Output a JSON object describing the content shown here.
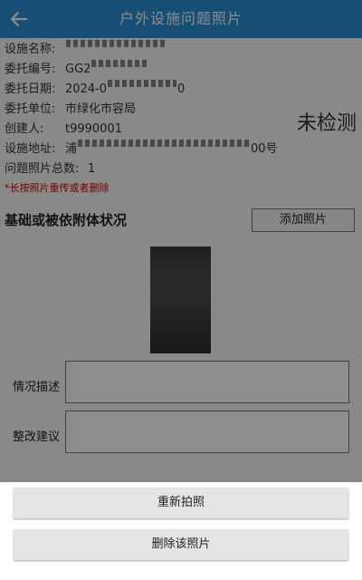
{
  "header": {
    "title": "户外设施问题照片",
    "back_icon": "arrow-left-icon"
  },
  "info": {
    "name_label": "设施名称:",
    "name_value": "",
    "code_label": "委托编号:",
    "code_value": "GG2",
    "date_label": "委托日期:",
    "date_value": "2024-0",
    "date_tail": "0",
    "unit_label": "委托单位:",
    "unit_value": "市绿化市容局",
    "creator_label": "创建人:",
    "creator_value": "t9990001",
    "address_label": "设施地址:",
    "address_value": "浦",
    "address_tail": "00号",
    "count_label": "问题照片总数:",
    "count_value": "1",
    "hint": "*长按照片重传或者删除"
  },
  "status": "未检测",
  "section": {
    "title": "基础或被依附体状况",
    "add_button": "添加照片"
  },
  "form": {
    "desc_label": "情况描述",
    "suggest_label": "整改建议"
  },
  "sheet": {
    "retake": "重新拍照",
    "delete": "删除该照片"
  },
  "colors": {
    "primary": "#2a8fd6",
    "hint": "#d40000"
  }
}
